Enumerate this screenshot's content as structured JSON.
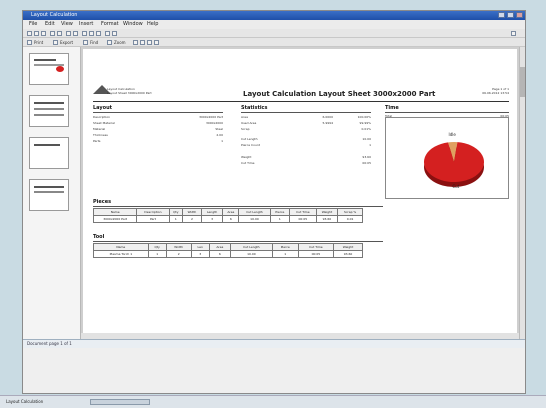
{
  "window": {
    "title": "Layout Calculation"
  },
  "menus": [
    "File",
    "Edit",
    "View",
    "Insert",
    "Format",
    "Window",
    "Help"
  ],
  "toolbar2": [
    "Print",
    "Export",
    "Find",
    "Zoom"
  ],
  "report": {
    "logo_line1": "Layout Calculation",
    "logo_line2": "Layout Sheet 3000x2000 Part",
    "title": "Layout Calculation Layout Sheet 3000x2000 Part",
    "right_line1": "Page 1 of 1",
    "right_line2": "06.06.2012 13:54",
    "layout": {
      "heading": "Layout",
      "rows": [
        {
          "k": "Description",
          "v": "3000x2000 Part"
        },
        {
          "k": "Sheet Material",
          "v": "3000x2000"
        },
        {
          "k": "Material",
          "v": "Steel"
        },
        {
          "k": "Thickness",
          "v": "2.00"
        },
        {
          "k": "Parts",
          "v": "1"
        }
      ]
    },
    "statistics": {
      "heading": "Statistics",
      "rows": [
        {
          "k": "Area",
          "v1": "6.0000",
          "v2": "100.00%"
        },
        {
          "k": "Used Area",
          "v1": "5.9994",
          "v2": "99.99%"
        },
        {
          "k": "Scrap",
          "v1": "",
          "v2": "0.01%"
        },
        {
          "k": "Cut Length",
          "v1": "",
          "v2": "10.00"
        },
        {
          "k": "Pierce Count",
          "v1": "",
          "v2": "1"
        },
        {
          "k": "Weight",
          "v1": "",
          "v2": "93.60"
        },
        {
          "k": "Cut Time",
          "v1": "",
          "v2": "00:05"
        }
      ]
    },
    "time": {
      "heading": "Time",
      "label": "Total",
      "value": "00:05",
      "pie_labels": [
        "Idle",
        "Cut"
      ]
    },
    "pieces": {
      "heading": "Pieces",
      "columns": [
        "Name",
        "Description",
        "Qty",
        "Width",
        "Length",
        "Area",
        "Cut Length",
        "Pierce",
        "Cut Time",
        "Weight",
        "Scrap %"
      ],
      "rows": [
        [
          "3000x2000 Part",
          "Part",
          "1",
          "2",
          "3",
          "6",
          "10.00",
          "1",
          "00:05",
          "93.60",
          "0.01"
        ]
      ]
    },
    "tools": {
      "heading": "Tool",
      "columns": [
        "Name",
        "Qty",
        "Width",
        "Len",
        "Area",
        "Cut Length",
        "Pierce",
        "Cut Time",
        "Weight"
      ],
      "rows": [
        [
          "Plasma Torch 1",
          "1",
          "2",
          "3",
          "6",
          "10.00",
          "1",
          "00:05",
          "93.60"
        ]
      ]
    }
  },
  "chart_data": {
    "type": "pie",
    "title": "",
    "slices": [
      {
        "label": "Idle",
        "value": 5,
        "color": "#e0a060"
      },
      {
        "label": "Cut",
        "value": 95,
        "color": "#d42020"
      }
    ]
  },
  "status": {
    "text": "Document page 1 of 1"
  },
  "taskbar": {
    "text": "Layout Calculation"
  }
}
